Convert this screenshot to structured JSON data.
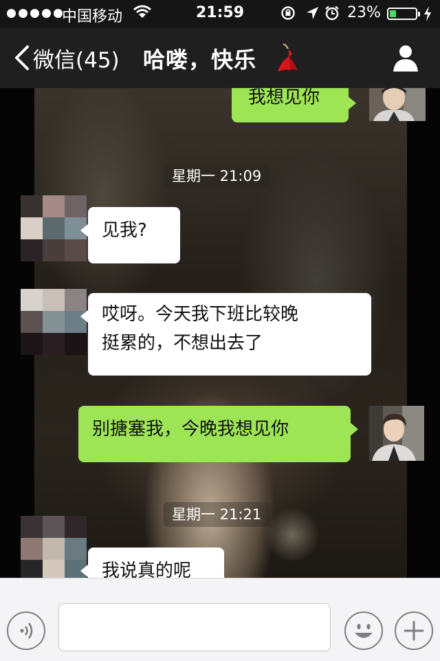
{
  "status_bar": {
    "carrier": "中国移动",
    "time": "21:59",
    "battery_percent_label": "23%",
    "battery_level": 0.23,
    "icons": [
      "signal-dots-icon",
      "wifi-icon",
      "rotation-lock-icon",
      "location-arrow-icon",
      "alarm-clock-icon",
      "battery-icon",
      "charging-bolt-icon"
    ]
  },
  "nav": {
    "back_label": "微信(45)",
    "title": "哈喽，快乐",
    "title_emoji_icon": "dancer-icon",
    "profile_icon": "person-icon"
  },
  "chat": {
    "messages": [
      {
        "side": "out",
        "text": "我想见你"
      },
      {
        "type": "time",
        "text": "星期一 21:09"
      },
      {
        "side": "in",
        "text": "见我?"
      },
      {
        "side": "in",
        "text": "哎呀。今天我下班比较晚",
        "text2": "挺累的，不想出去了"
      },
      {
        "side": "out",
        "text": "别搪塞我，今晚我想见你"
      },
      {
        "type": "time",
        "text": "星期一 21:21"
      },
      {
        "side": "in",
        "text": "我说真的呢"
      }
    ]
  },
  "input_bar": {
    "voice_icon": "voice-icon",
    "message_value": "",
    "message_placeholder": "",
    "emoji_icon": "smiley-icon",
    "more_icon": "plus-icon"
  },
  "colors": {
    "status_bar_bg": "#151515",
    "nav_bg": "#1f1f1f",
    "outgoing_bubble": "#9ee556",
    "incoming_bubble": "#ffffff",
    "battery_fill": "#4cd964",
    "input_bar_bg": "#f4f4f6"
  }
}
